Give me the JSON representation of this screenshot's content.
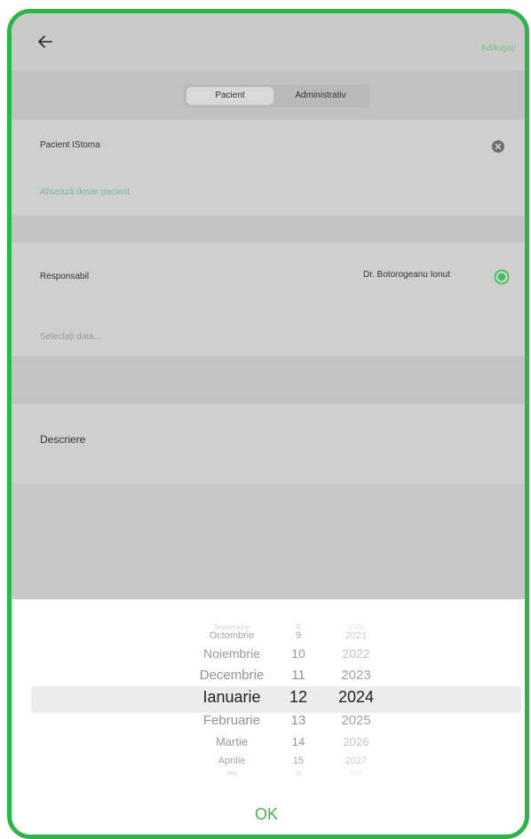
{
  "header": {
    "back_icon": "arrow-left-icon",
    "add_label": "Adăugați"
  },
  "tabs": [
    {
      "label": "Pacient"
    },
    {
      "label": "Administrativ"
    }
  ],
  "form": {
    "patient_value": "Pacient IStoma",
    "patient_file_link": "Afișează dosar pacient",
    "responsible_label": "Responsabil",
    "responsible_value": "Dr. Botorogeanu Ionut",
    "date_placeholder": "Selectați data...",
    "description_label": "Descriere"
  },
  "picker": {
    "months": [
      "Septembrie",
      "Octombrie",
      "Noiembrie",
      "Decembrie",
      "Ianuarie",
      "Februarie",
      "Martie",
      "Aprilie",
      "Mai"
    ],
    "days": [
      "8",
      "9",
      "10",
      "11",
      "12",
      "13",
      "14",
      "15",
      "16"
    ],
    "years": [
      "2020",
      "2021",
      "2022",
      "2023",
      "2024",
      "2025",
      "2026",
      "2027",
      "2028"
    ],
    "selected_index": 4,
    "ok_label": "OK"
  },
  "colors": {
    "accent": "#4caf50",
    "frame": "#2fb34a",
    "overlay": "#cfcfcf"
  }
}
